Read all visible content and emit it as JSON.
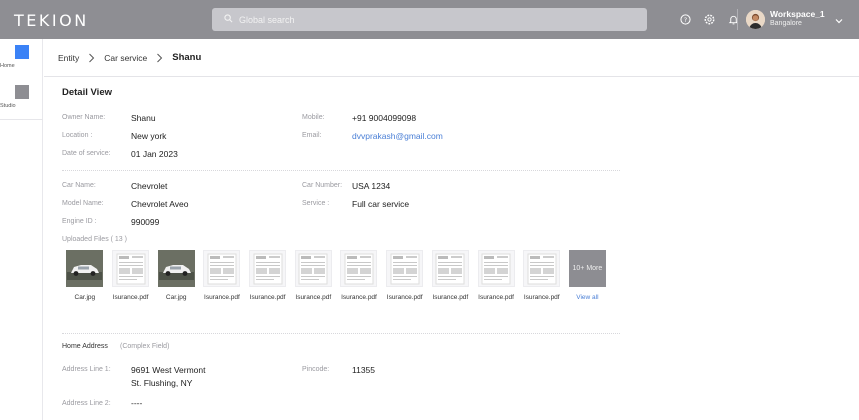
{
  "topbar": {
    "logo": "TEKION",
    "search_placeholder": "Global search",
    "workspace_name": "Workspace_1",
    "workspace_location": "Bangalore"
  },
  "leftnav": {
    "items": [
      {
        "label": "Home",
        "color": "#3b82f6"
      },
      {
        "label": "Studio",
        "color": "#8e8e93"
      }
    ]
  },
  "breadcrumb": {
    "items": [
      "Entity",
      "Car service"
    ],
    "current": "Shanu"
  },
  "detail": {
    "title": "Detail View",
    "owner_label": "Owner Name:",
    "owner": "Shanu",
    "mobile_label": "Mobile:",
    "mobile": "+91 9004099098",
    "location_label": "Location :",
    "location": "New york",
    "email_label": "Email:",
    "email": "dvvprakash@gmail.com",
    "date_label": "Date of service:",
    "date": "01  Jan 2023",
    "car_name_label": "Car Name:",
    "car_name": "Chevrolet",
    "car_number_label": "Car Number:",
    "car_number": "USA 1234",
    "model_label": "Model Name:",
    "model": "Chevrolet Aveo",
    "service_label": "Service :",
    "service": "Full car service",
    "engine_label": "Engine ID :",
    "engine": "990099",
    "files_label": "Uploaded Files ( 13 )",
    "files": [
      {
        "name": "Car.jpg",
        "kind": "car"
      },
      {
        "name": "Isurance.pdf",
        "kind": "doc"
      },
      {
        "name": "Car.jpg",
        "kind": "car"
      },
      {
        "name": "Isurance.pdf",
        "kind": "doc"
      },
      {
        "name": "Isurance.pdf",
        "kind": "doc"
      },
      {
        "name": "Isurance.pdf",
        "kind": "doc"
      },
      {
        "name": "Isurance.pdf",
        "kind": "doc"
      },
      {
        "name": "Isurance.pdf",
        "kind": "doc"
      },
      {
        "name": "Isurance.pdf",
        "kind": "doc"
      },
      {
        "name": "Isurance.pdf",
        "kind": "doc"
      },
      {
        "name": "Isurance.pdf",
        "kind": "doc"
      }
    ],
    "more_label": "10+ More",
    "view_all": "View all",
    "home_address_label": "Home Address",
    "complex_field": "(Complex Field)",
    "address1_label": "Address Line 1:",
    "address1_line1": "9691 West Vermont",
    "address1_line2": "St. Flushing, NY",
    "pincode_label": "Pincode:",
    "pincode": "11355",
    "address2_label": "Address Line 2:",
    "address2": "----"
  }
}
